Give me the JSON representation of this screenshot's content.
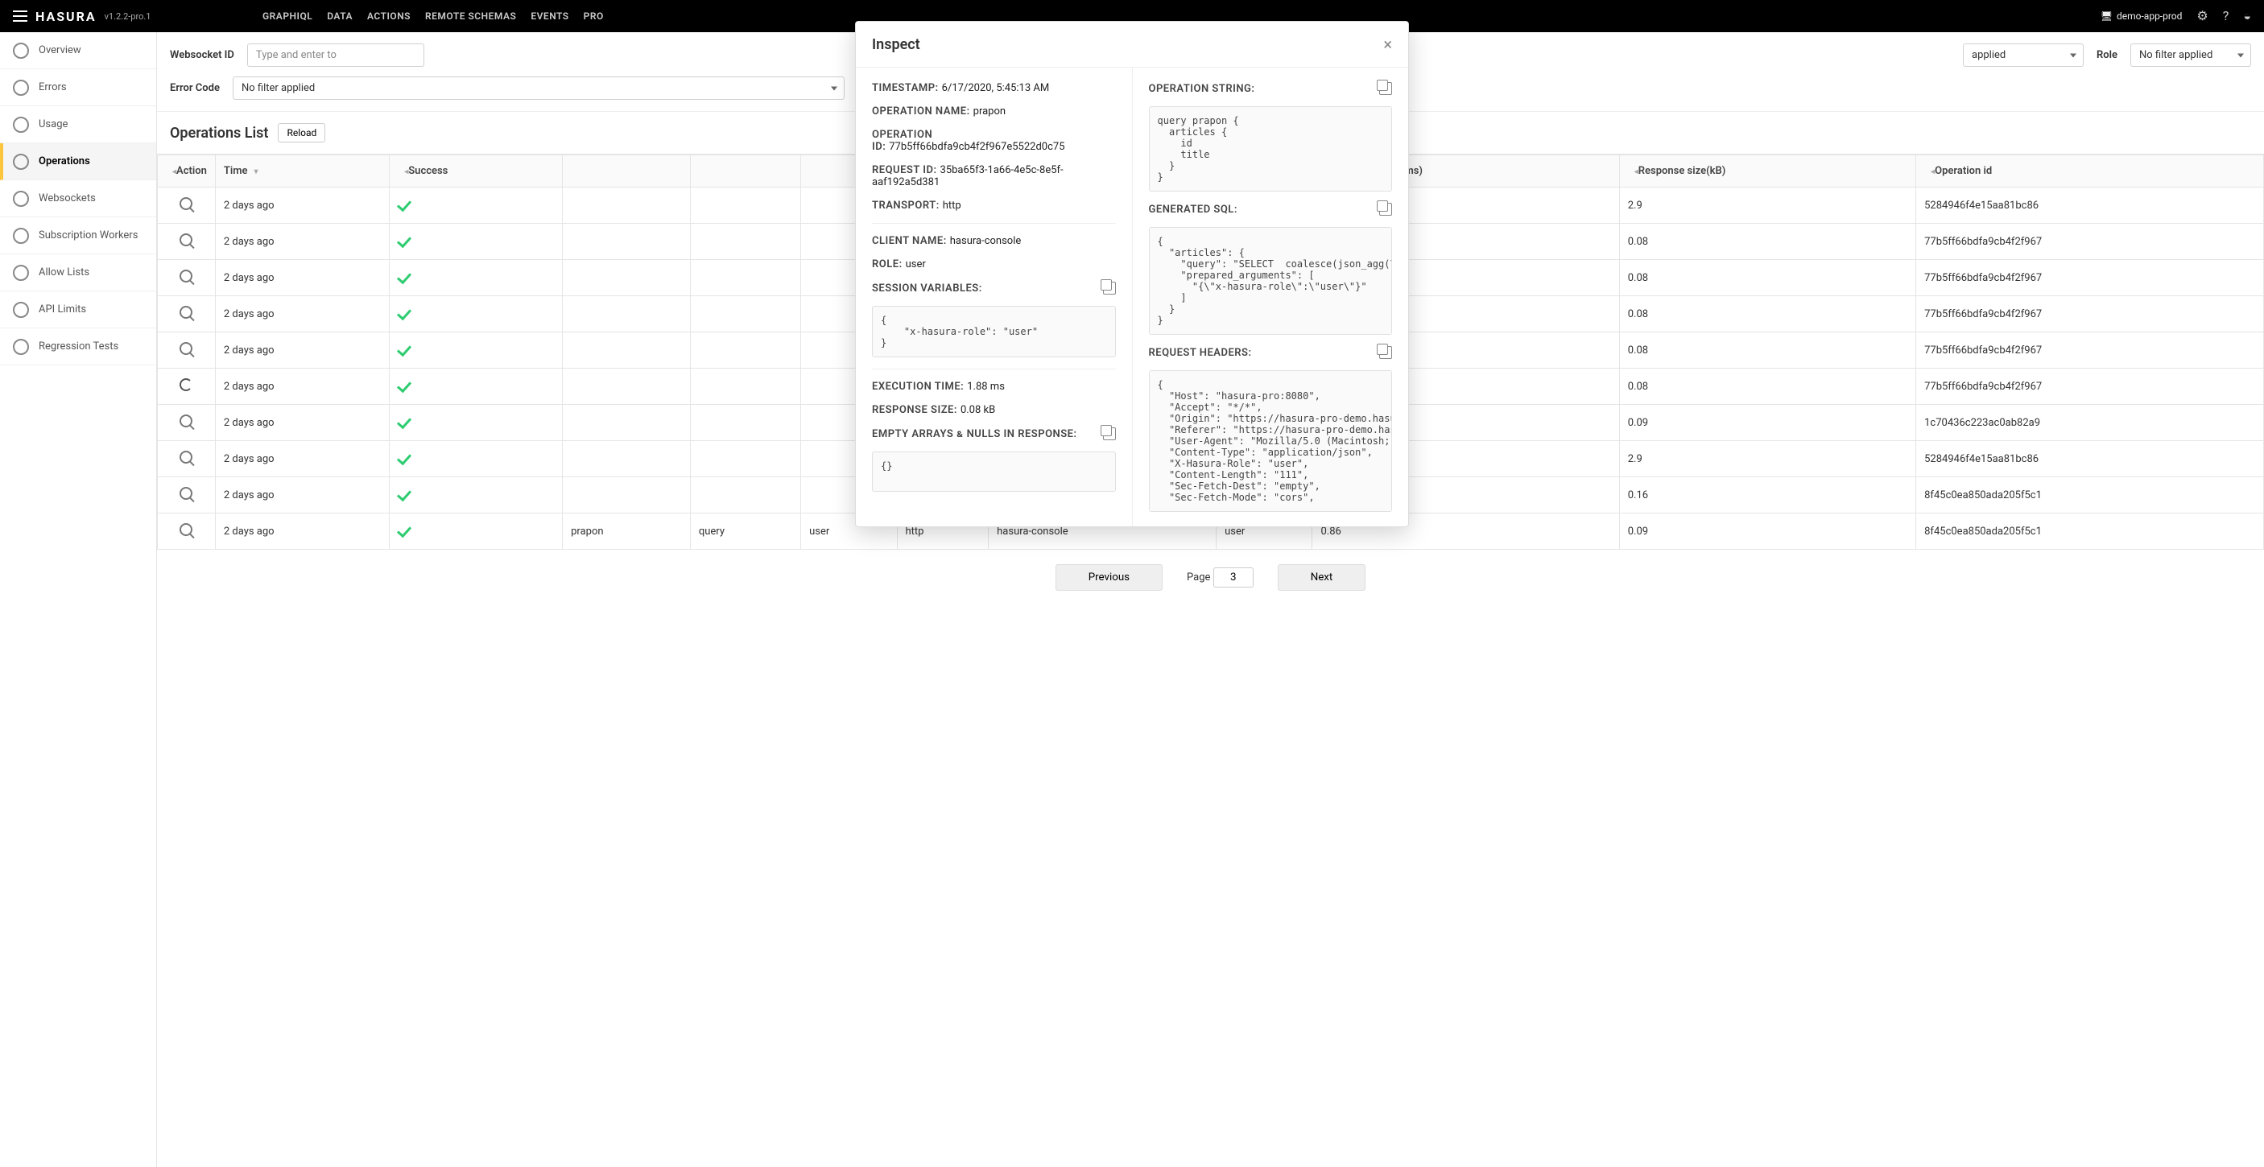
{
  "brand": {
    "logo": "HASURA",
    "version": "v1.2.2-pro.1"
  },
  "topnav": {
    "items": [
      {
        "label": "GRAPHIQL"
      },
      {
        "label": "DATA"
      },
      {
        "label": "ACTIONS"
      },
      {
        "label": "REMOTE SCHEMAS"
      },
      {
        "label": "EVENTS"
      },
      {
        "label": "PRO"
      }
    ],
    "project": "demo-app-prod"
  },
  "sidebar": {
    "items": [
      {
        "label": "Overview"
      },
      {
        "label": "Errors"
      },
      {
        "label": "Usage"
      },
      {
        "label": "Operations"
      },
      {
        "label": "Websockets"
      },
      {
        "label": "Subscription Workers"
      },
      {
        "label": "Allow Lists"
      },
      {
        "label": "API Limits"
      },
      {
        "label": "Regression Tests"
      }
    ]
  },
  "filters": {
    "websocket_id": {
      "label": "Websocket ID",
      "placeholder": "Type and enter to"
    },
    "error_code": {
      "label": "Error Code",
      "value": "No filter applied"
    },
    "hidden_group1": {
      "value": "applied"
    },
    "role": {
      "label": "Role",
      "value": "No filter applied"
    }
  },
  "list": {
    "title": "Operations List",
    "reload": "Reload",
    "columns": [
      "Action",
      "Time",
      "Success",
      "",
      "",
      "",
      "",
      "",
      "",
      "Execution time(ms)",
      "Response size(kB)",
      "Operation id"
    ],
    "rows": [
      {
        "time": "2 days ago",
        "ok": true,
        "resp": "2.9",
        "opid": "5284946f4e15aa81bc86"
      },
      {
        "time": "2 days ago",
        "ok": true,
        "resp": "0.08",
        "opid": "77b5ff66bdfa9cb4f2f967"
      },
      {
        "time": "2 days ago",
        "ok": true,
        "resp": "0.08",
        "opid": "77b5ff66bdfa9cb4f2f967"
      },
      {
        "time": "2 days ago",
        "ok": true,
        "resp": "0.08",
        "opid": "77b5ff66bdfa9cb4f2f967"
      },
      {
        "time": "2 days ago",
        "ok": true,
        "resp": "0.08",
        "opid": "77b5ff66bdfa9cb4f2f967"
      },
      {
        "time": "2 days ago",
        "ok": true,
        "resp": "0.08",
        "opid": "77b5ff66bdfa9cb4f2f967",
        "loading": true
      },
      {
        "time": "2 days ago",
        "ok": true,
        "resp": "0.09",
        "opid": "1c70436c223ac0ab82a9"
      },
      {
        "time": "2 days ago",
        "ok": true,
        "resp": "2.9",
        "opid": "5284946f4e15aa81bc86"
      },
      {
        "time": "2 days ago",
        "ok": true,
        "name": "",
        "type": "",
        "trans": "",
        "client": "",
        "role": "",
        "exec": "",
        "resp": "0.16",
        "opid": "8f45c0ea850ada205f5c1"
      },
      {
        "time": "2 days ago",
        "ok": true,
        "name": "prapon",
        "type": "query",
        "trans": "http",
        "client": "hasura-console",
        "role": "user",
        "exec": "0.86",
        "resp": "0.09",
        "opid": "8f45c0ea850ada205f5c1",
        "obscured": false
      }
    ],
    "pagination": {
      "previous": "Previous",
      "next": "Next",
      "page_label": "Page",
      "page": "3"
    }
  },
  "modal": {
    "title": "Inspect",
    "left": {
      "timestamp": {
        "k": "TIMESTAMP:",
        "v": "6/17/2020, 5:45:13 AM"
      },
      "operation_name": {
        "k": "OPERATION NAME:",
        "v": "prapon"
      },
      "operation_id": {
        "k": "OPERATION ID:",
        "v": "77b5ff66bdfa9cb4f2f967e5522d0c75"
      },
      "request_id": {
        "k": "REQUEST ID:",
        "v": "35ba65f3-1a66-4e5c-8e5f-aaf192a5d381"
      },
      "transport": {
        "k": "TRANSPORT:",
        "v": "http"
      },
      "client_name": {
        "k": "CLIENT NAME:",
        "v": "hasura-console"
      },
      "role": {
        "k": "ROLE:",
        "v": "user"
      },
      "session_vars_label": "SESSION VARIABLES:",
      "session_vars_code": "{\n    \"x-hasura-role\": \"user\"\n}",
      "execution_time": {
        "k": "EXECUTION TIME:",
        "v": "1.88 ms"
      },
      "response_size": {
        "k": "RESPONSE SIZE:",
        "v": "0.08 kB"
      },
      "empty_label": "EMPTY ARRAYS & NULLS IN RESPONSE:",
      "empty_code": "{}"
    },
    "right": {
      "op_string_label": "OPERATION STRING:",
      "op_string_code": "query prapon {\n  articles {\n    id\n    title\n  }\n}",
      "sql_label": "GENERATED SQL:",
      "sql_code": "{\n  \"articles\": {\n    \"query\": \"SELECT  coalesce(json_agg(\\\"root\\\"\n    \"prepared_arguments\": [\n      \"{\\\"x-hasura-role\\\":\\\"user\\\"}\"\n    ]\n  }\n}",
      "headers_label": "REQUEST HEADERS:",
      "headers_code": "{\n  \"Host\": \"hasura-pro:8080\",\n  \"Accept\": \"*/*\",\n  \"Origin\": \"https://hasura-pro-demo.hasura-ap\n  \"Referer\": \"https://hasura-pro-demo.hasura-ap\n  \"User-Agent\": \"Mozilla/5.0 (Macintosh; Intel\n  \"Content-Type\": \"application/json\",\n  \"X-Hasura-Role\": \"user\",\n  \"Content-Length\": \"111\",\n  \"Sec-Fetch-Dest\": \"empty\",\n  \"Sec-Fetch-Mode\": \"cors\","
    }
  }
}
